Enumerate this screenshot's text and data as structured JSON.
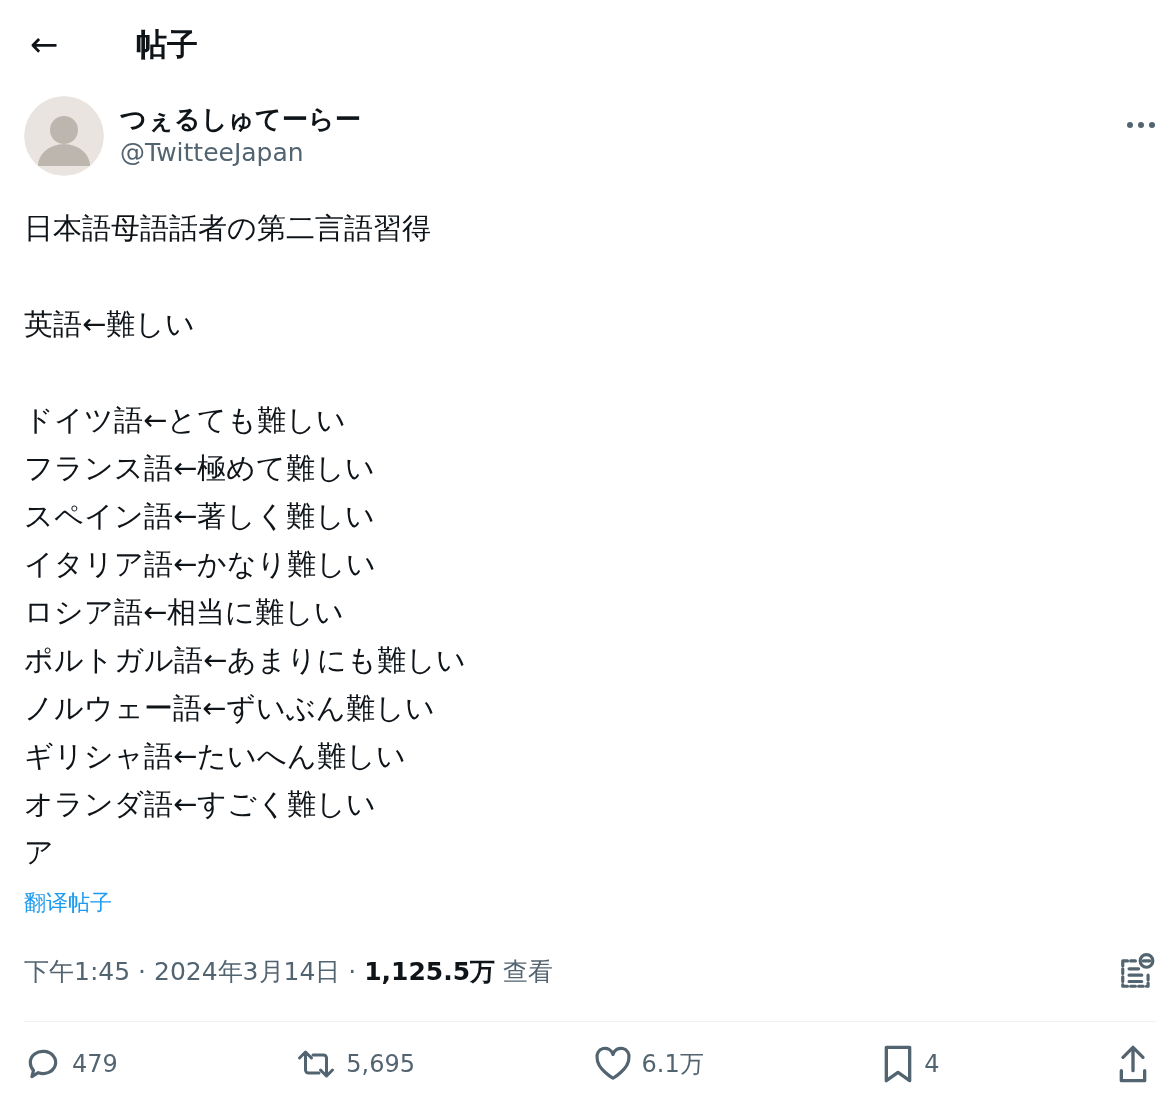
{
  "header": {
    "back": "←",
    "title": "帖子"
  },
  "author": {
    "name": "つぇるしゅてーらー",
    "handle": "@TwitteeJapan"
  },
  "post": {
    "paragraphs": [
      [
        "日本語母語話者の第二言語習得"
      ],
      [
        "英語←難しい"
      ],
      [
        "ドイツ語←とても難しい",
        "フランス語←極めて難しい",
        "スペイン語←著しく難しい",
        "イタリア語←かなり難しい",
        "ロシア語←相当に難しい",
        "ポルトガル語←あまりにも難しい",
        "ノルウェー語←ずいぶん難しい",
        "ギリシャ語←たいへん難しい",
        "オランダ語←すごく難しい",
        "ア"
      ]
    ],
    "translate": "翻译帖子"
  },
  "meta": "下午1:45 · 2024年3月14日 · **1,125.5万** 查看",
  "actions": [
    {
      "kind": "reply",
      "count": "479"
    },
    {
      "kind": "repost",
      "count": "5,695"
    },
    {
      "kind": "like",
      "count": "6.1万"
    },
    {
      "kind": "bookmark",
      "count": "4"
    },
    {
      "kind": "share"
    }
  ]
}
